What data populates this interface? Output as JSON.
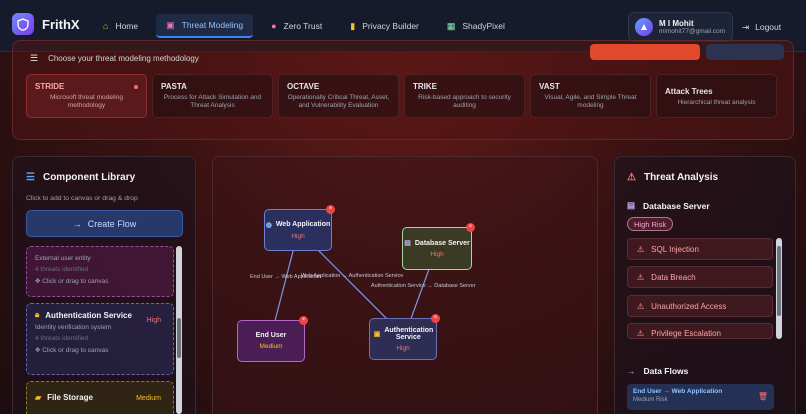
{
  "app": {
    "name": "FrithX"
  },
  "nav": {
    "items": [
      {
        "label": "Home",
        "icon": "home-icon"
      },
      {
        "label": "Threat Modeling",
        "icon": "threat-modeling-icon"
      },
      {
        "label": "Zero Trust",
        "icon": "zero-trust-icon"
      },
      {
        "label": "Privacy Builder",
        "icon": "privacy-builder-icon"
      },
      {
        "label": "ShadyPixel",
        "icon": "image-icon"
      }
    ],
    "active": "Threat Modeling"
  },
  "user": {
    "name": "M I Mohit",
    "email": "mimohit77@gmail.com",
    "initial": ""
  },
  "logout_label": "Logout",
  "methodology": {
    "heading": "Choose your threat modeling methodology",
    "cards": [
      {
        "title": "STRIDE",
        "desc": "Microsoft threat modeling methodology"
      },
      {
        "title": "PASTA",
        "desc": "Process for Attack Simulation and Threat Analysis"
      },
      {
        "title": "OCTAVE",
        "desc": "Operationally Critical Threat, Asset, and Vulnerability Evaluation"
      },
      {
        "title": "TRIKE",
        "desc": "Risk-based approach to security auditing"
      },
      {
        "title": "VAST",
        "desc": "Visual, Agile, and Simple Threat modeling"
      },
      {
        "title": "Attack Trees",
        "desc": "Hierarchical threat analysis"
      }
    ],
    "selected": "STRIDE"
  },
  "library": {
    "title": "Component Library",
    "subtitle": "Click to add to canvas or drag & drop",
    "create_flow_label": "Create Flow",
    "items": [
      {
        "name": "",
        "desc": "External user entity",
        "threats": "4 threats identified",
        "hint": "Click or drag to canvas",
        "risk": ""
      },
      {
        "name": "Authentication Service",
        "desc": "Identity verification system",
        "threats": "4 threats identified",
        "hint": "Click or drag to canvas",
        "risk": "High"
      },
      {
        "name": "File Storage",
        "desc": "",
        "threats": "",
        "hint": "",
        "risk": "Medium"
      }
    ]
  },
  "canvas": {
    "nodes": [
      {
        "id": "web",
        "name": "Web Application",
        "risk": "High"
      },
      {
        "id": "db",
        "name": "Database Server",
        "risk": "High"
      },
      {
        "id": "user",
        "name": "End User",
        "risk": "Medium"
      },
      {
        "id": "auth",
        "name": "Authentication Service",
        "risk": "High"
      }
    ],
    "edges": [
      {
        "label": "End User → Web Application"
      },
      {
        "label": "Web Application → Authentication Service"
      },
      {
        "label": "Authentication Service → Database Server"
      }
    ]
  },
  "analysis": {
    "title": "Threat Analysis",
    "selected_component": "Database Server",
    "risk_badge": "High Risk",
    "threats": [
      "SQL Injection",
      "Data Breach",
      "Unauthorized Access",
      "Privilege Escalation"
    ],
    "data_flows_title": "Data Flows",
    "flows": [
      {
        "label": "End User → Web Application",
        "risk": "Medium Risk"
      }
    ]
  },
  "colors": {
    "accent": "#3b82f6",
    "high": "#ef4444",
    "medium": "#f59e0b"
  }
}
